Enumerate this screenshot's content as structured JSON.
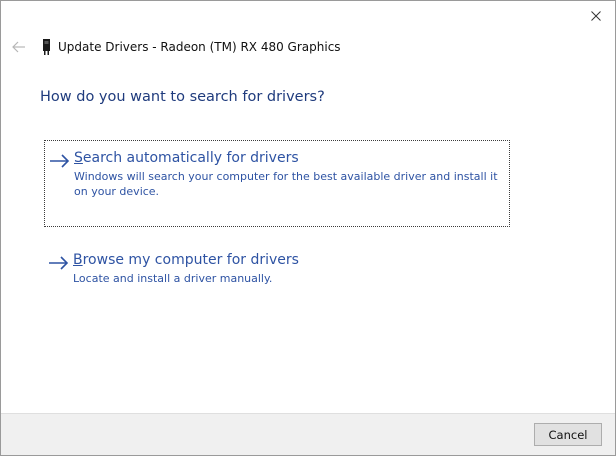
{
  "window": {
    "title": "Update Drivers - Radeon (TM) RX 480 Graphics"
  },
  "main": {
    "heading": "How do you want to search for drivers?",
    "options": [
      {
        "accelerator": "S",
        "title_rest": "earch automatically for drivers",
        "description": "Windows will search your computer for the best available driver and install it on your device."
      },
      {
        "accelerator": "B",
        "title_rest": "rowse my computer for drivers",
        "description": "Locate and install a driver manually."
      }
    ]
  },
  "footer": {
    "cancel_label": "Cancel"
  },
  "icons": {
    "close": "close-icon",
    "back": "back-arrow-icon",
    "device": "graphics-card-icon",
    "option_arrow": "arrow-right-icon"
  },
  "colors": {
    "heading": "#1f3b7d",
    "link": "#2e53a3",
    "footer_bg": "#f0f0f0",
    "button_bg": "#e1e1e1"
  }
}
